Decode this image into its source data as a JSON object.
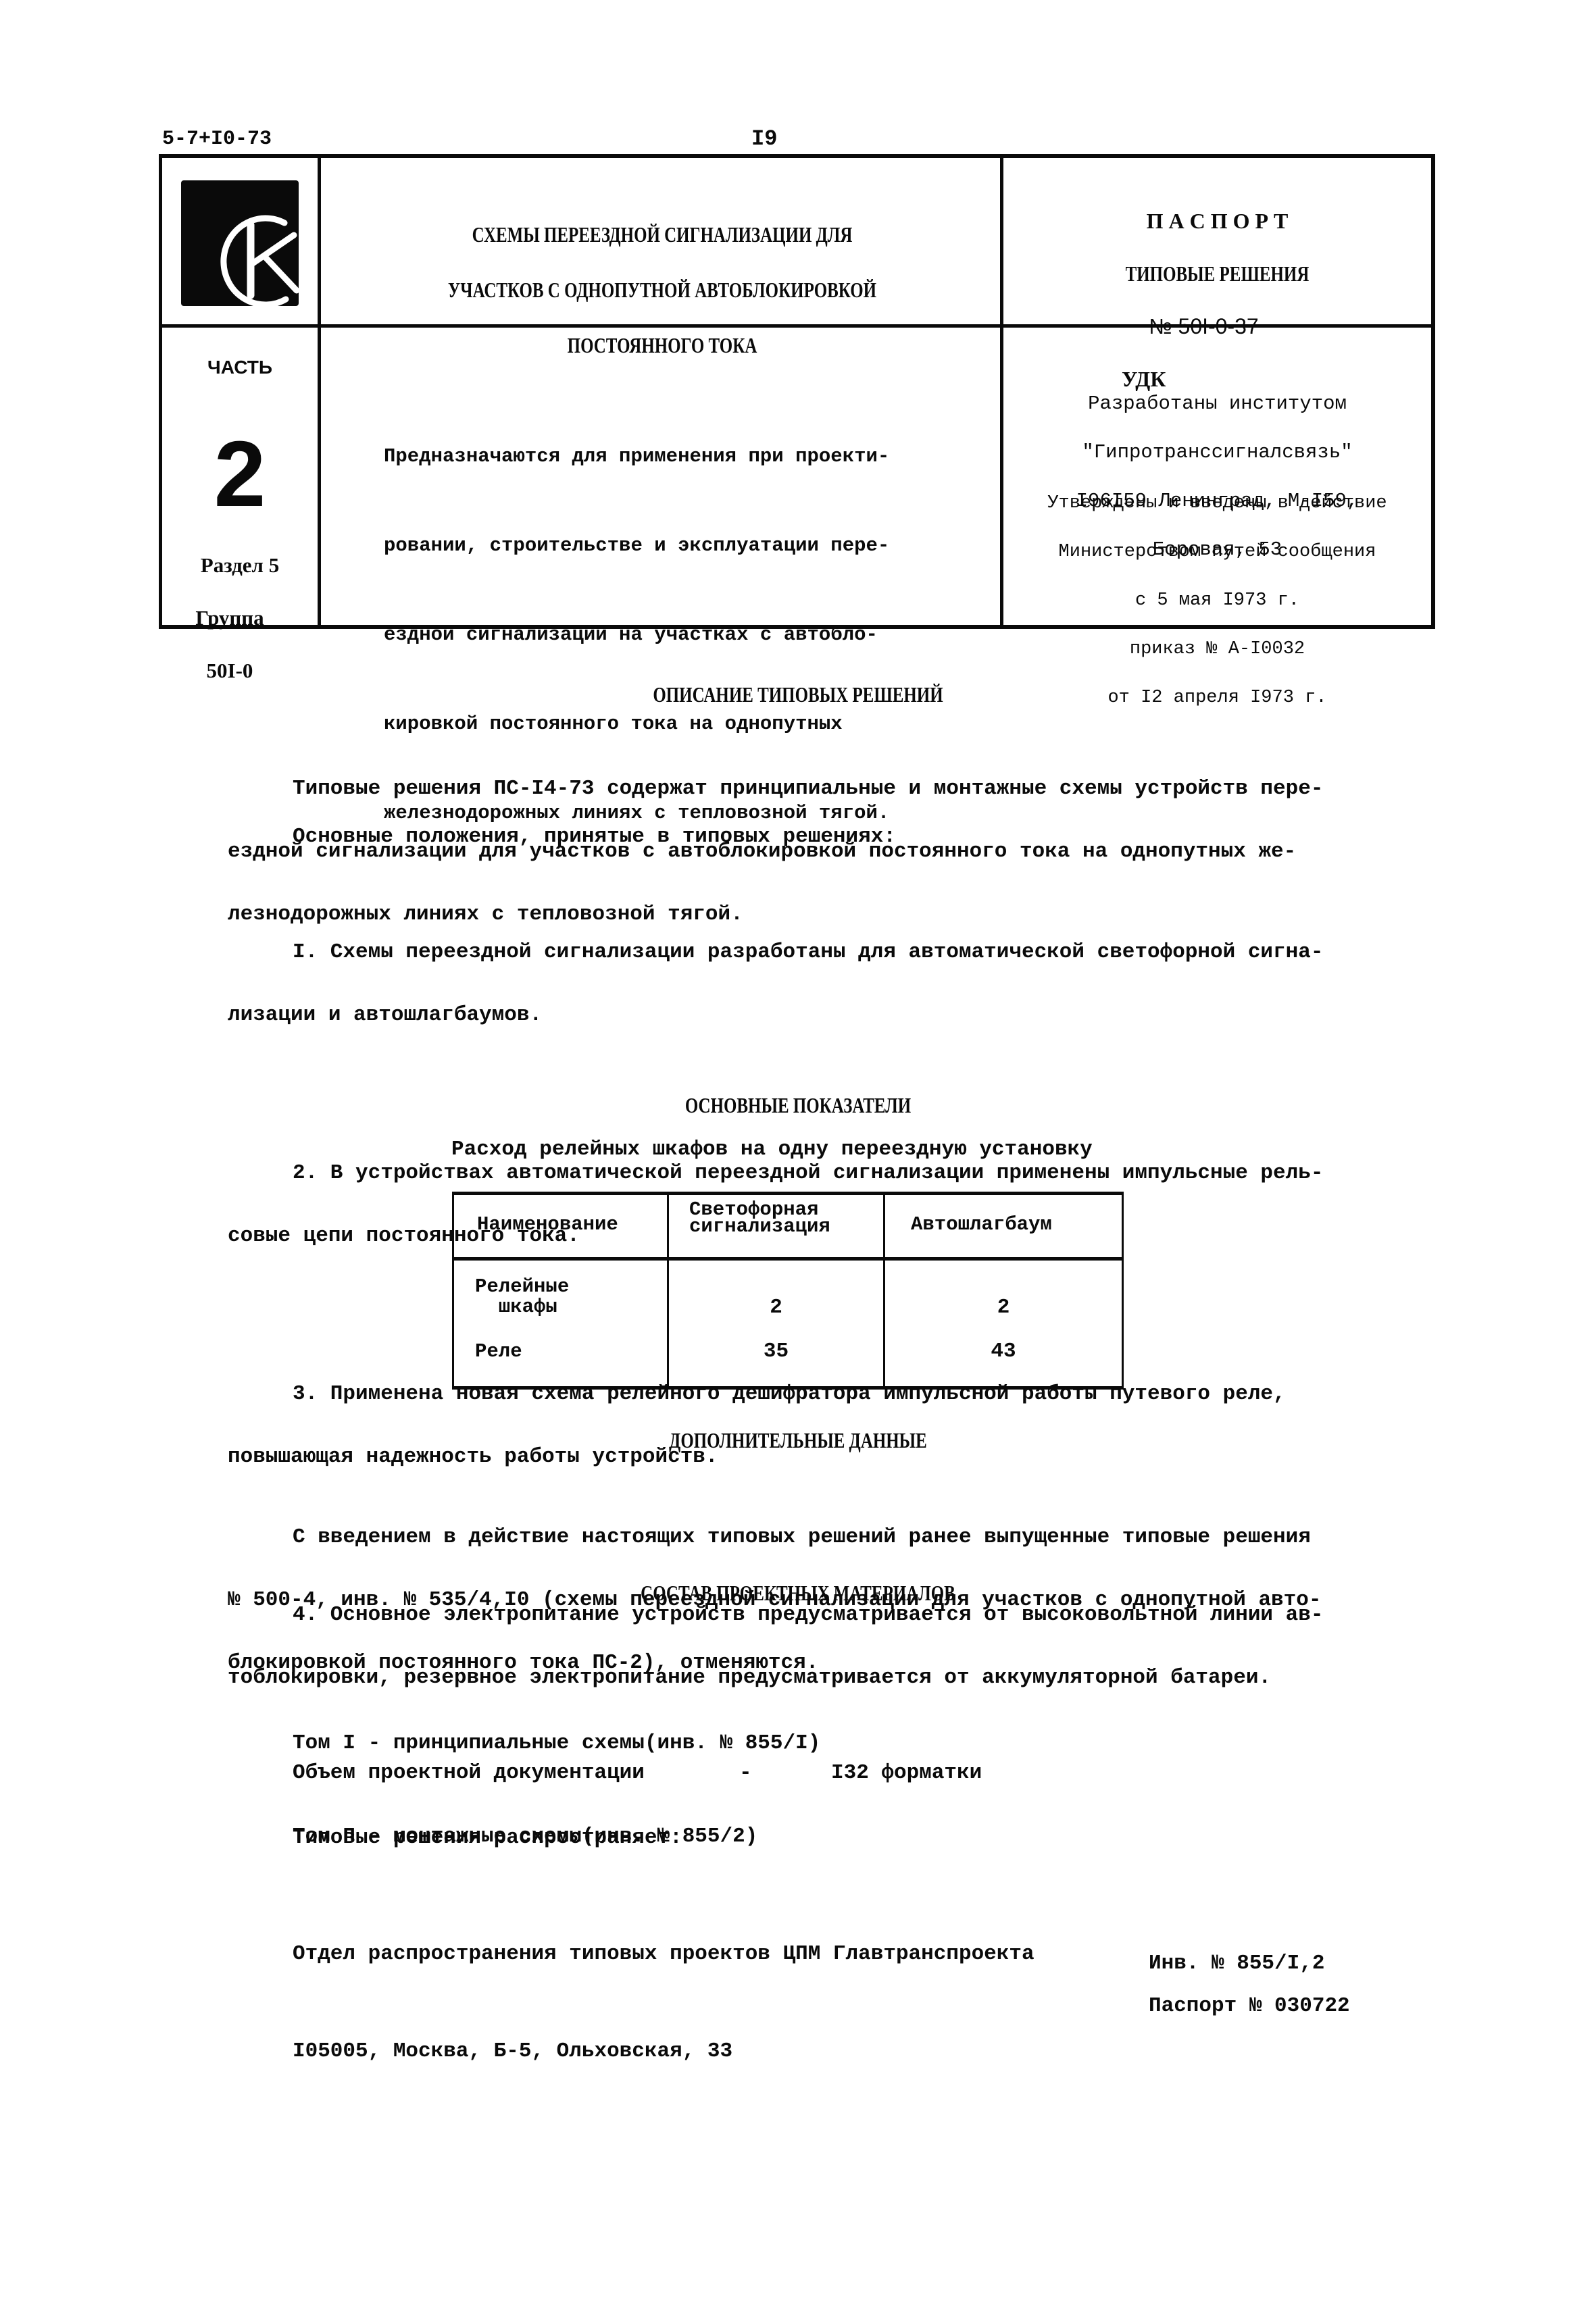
{
  "page": {
    "doc_code": "5-7+I0-73",
    "page_number": "I9"
  },
  "header": {
    "logo_letters": "СК",
    "title_lines": [
      "СХЕМЫ ПЕРЕЕЗДНОЙ СИГНАЛИЗАЦИИ ДЛЯ",
      "УЧАСТКОВ С ОДНОПУТНОЙ АВТОБЛОКИРОВКОЙ",
      "ПОСТОЯННОГО ТОКА"
    ],
    "passport": {
      "label": "П А С П О Р Т",
      "subtitle": "ТИПОВЫЕ РЕШЕНИЯ",
      "number": "№ 50I-0-37",
      "udk": "УДК"
    },
    "part": {
      "label": "ЧАСТЬ",
      "number": "2",
      "section": "Раздел 5",
      "group_label": "Группа",
      "group": "50I-0"
    },
    "purpose_lines": [
      "Предназначаются для применения при проекти-",
      "ровании, строительстве и эксплуатации пере-",
      "ездной сигнализации на участках с автобло-",
      "кировкой постоянного тока на однопутных",
      "железнодорожных линиях с тепловозной тягой."
    ],
    "developer_lines": [
      "Разработаны институтом",
      "\"Гипротранссигналсвязь\"",
      "I96I59 Ленинград, М-I59,",
      "Боровая, 53"
    ],
    "approval_lines": [
      "Утверждены и введены в действие",
      "Министерством путей сообщения",
      "с 5 мая I973 г.",
      "приказ № А-I0032",
      "от I2 апреля I973 г."
    ]
  },
  "description": {
    "heading": "ОПИСАНИЕ ТИПОВЫХ РЕШЕНИЙ",
    "intro_lines": [
      "Типовые решения ПС-I4-73 содержат принципиальные и монтажные схемы устройств пере-",
      "ездной сигнализации для участков с автоблокировкой постоянного тока на однопутных же-",
      "лезнодорожных линиях с тепловозной тягой."
    ],
    "positions_label": "Основные положения, принятые в типовых решениях:",
    "items": [
      [
        "I. Схемы переездной сигнализации разработаны для автоматической светофорной сигна-",
        "лизации и автошлагбаумов."
      ],
      [
        "2. В устройствах автоматической переездной сигнализации применены импульсные рель-",
        "совые цепи постоянного тока."
      ],
      [
        "3. Применена новая схема релейного дешифратора импульсной работы путевого реле,",
        "повышающая надежность работы устройств."
      ],
      [
        "4. Основное электропитание устройств предусматривается от высоковольтной линии ав-",
        "тоблокировки, резервное электропитание предусматривается от аккумуляторной батареи."
      ]
    ]
  },
  "indicators": {
    "heading": "ОСНОВНЫЕ ПОКАЗАТЕЛИ",
    "caption": "Расход релейных шкафов на одну переездную установку",
    "columns": [
      "Наименование",
      "Светофорная\nсигнализация",
      "Автошлагбаум"
    ],
    "rows": [
      {
        "name": "Релейные\n  шкафы",
        "values": [
          "2",
          "2"
        ]
      },
      {
        "name": "Реле",
        "values": [
          "35",
          "43"
        ]
      }
    ]
  },
  "additional": {
    "heading": "ДОПОЛНИТЕЛЬНЫЕ ДАННЫЕ",
    "lines": [
      "С введением в действие настоящих типовых решений ранее выпущенные типовые решения",
      "№ 500-4, инв. № 535/4,I0 (схемы переездной сигнализации для участков с однопутной авто-",
      "блокировкой постоянного тока ПС-2), отменяются."
    ]
  },
  "materials": {
    "heading": "СОСТАВ ПРОЕКТНЫХ МАТЕРИАЛОВ",
    "volumes": [
      "Том I - принципиальные схемы(инв. № 855/I)",
      "Том П - монтажные схемы(инв. № 855/2)"
    ],
    "volume_label": "Объем проектной документации",
    "volume_dash": "-",
    "volume_value": "I32 форматки",
    "distributor_label": "Типовые решения распространяет:",
    "distributor_lines": [
      "Отдел распространения типовых проектов ЦПМ Главтранспроекта",
      "I05005, Москва, Б-5, Ольховская, 33"
    ]
  },
  "footer": {
    "inventory": "Инв. № 855/I,2",
    "passport_number": "Паспорт № 030722"
  }
}
